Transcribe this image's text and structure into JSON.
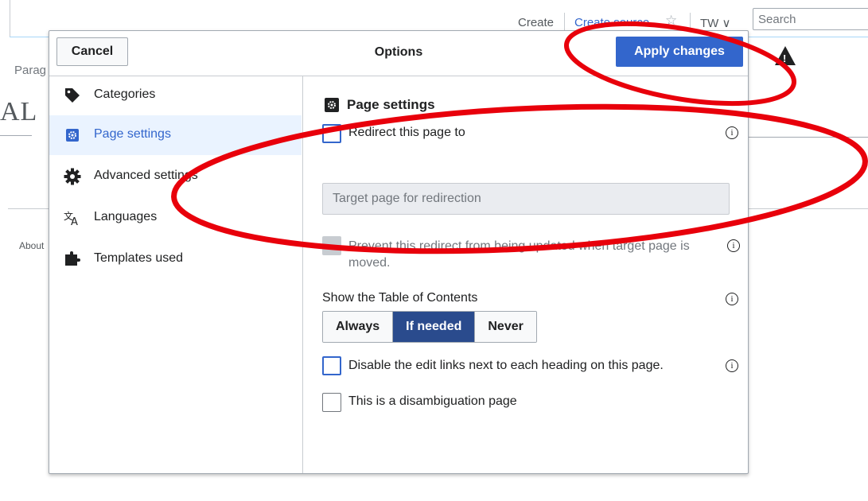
{
  "background": {
    "tabs": {
      "create": "Create",
      "create_source": "Create source",
      "tw": "TW ∨"
    },
    "search_placeholder": "Search",
    "toolbar_text": "Parag",
    "heading_fragment": "AL",
    "footer_link": "About"
  },
  "dialog": {
    "cancel_label": "Cancel",
    "title": "Options",
    "apply_label": "Apply changes"
  },
  "sidebar": {
    "items": [
      {
        "label": "Categories",
        "icon": "tag-icon",
        "active": false
      },
      {
        "label": "Page settings",
        "icon": "settings-page-icon",
        "active": true
      },
      {
        "label": "Advanced settings",
        "icon": "gear-icon",
        "active": false
      },
      {
        "label": "Languages",
        "icon": "language-icon",
        "active": false
      },
      {
        "label": "Templates used",
        "icon": "puzzle-icon",
        "active": false
      }
    ]
  },
  "panel": {
    "title": "Page settings",
    "redirect_label": "Redirect this page to",
    "redirect_checked": false,
    "target_placeholder": "Target page for redirection",
    "prevent_label": "Prevent this redirect from being updated when target page is moved.",
    "toc_label": "Show the Table of Contents",
    "toc_options": [
      "Always",
      "If needed",
      "Never"
    ],
    "toc_selected": "If needed",
    "disable_edit_label": "Disable the edit links next to each heading on this page.",
    "disambig_label": "This is a disambiguation page",
    "info_glyph": "i"
  },
  "colors": {
    "accent": "#3366cc",
    "selected_segment": "#2a4b8d",
    "annotation": "#e8000b",
    "active_item_bg": "#eaf3ff"
  }
}
